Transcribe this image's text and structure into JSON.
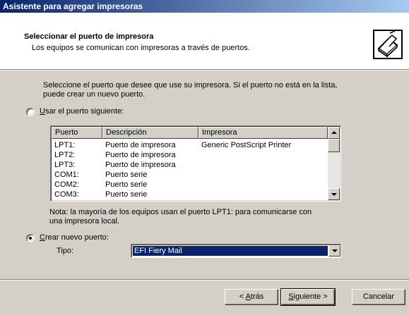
{
  "window": {
    "title": "Asistente para agregar impresoras"
  },
  "header": {
    "title": "Seleccionar el puerto de impresora",
    "subtitle": "Los equipos se comunican con impresoras a través de puertos.",
    "icon": "printer-wizard-icon"
  },
  "instructions": {
    "line1": "Seleccione el puerto que desee que use su impresora. Si el puerto no está en la lista,",
    "line2": "puede crear un nuevo puerto."
  },
  "option_existing": {
    "label_accel": "U",
    "label_rest": "sar el puerto siguiente:",
    "selected": false
  },
  "ports_table": {
    "columns": [
      "Puerto",
      "Descripción",
      "Impresora"
    ],
    "rows": [
      {
        "port": "LPT1:",
        "description": "Puerto de impresora",
        "printer": "Generic PostScript Printer"
      },
      {
        "port": "LPT2:",
        "description": "Puerto de impresora",
        "printer": ""
      },
      {
        "port": "LPT3:",
        "description": "Puerto de impresora",
        "printer": ""
      },
      {
        "port": "COM1:",
        "description": "Puerto serie",
        "printer": ""
      },
      {
        "port": "COM2:",
        "description": "Puerto serie",
        "printer": ""
      },
      {
        "port": "COM3:",
        "description": "Puerto serie",
        "printer": ""
      }
    ]
  },
  "note": {
    "line1": "Nota: la mayoría de los equipos usan el puerto LPT1: para comunicarse con",
    "line2": "una impresora local."
  },
  "option_new": {
    "label_accel": "C",
    "label_rest": "rear nuevo puerto:",
    "selected": true
  },
  "type_field": {
    "label": "Tipo:",
    "value": "EFI Fiery Mail"
  },
  "buttons": {
    "back_prefix": "< ",
    "back_accel": "A",
    "back_rest": "trás",
    "next_accel": "S",
    "next_rest": "iguiente >",
    "cancel": "Cancelar"
  }
}
